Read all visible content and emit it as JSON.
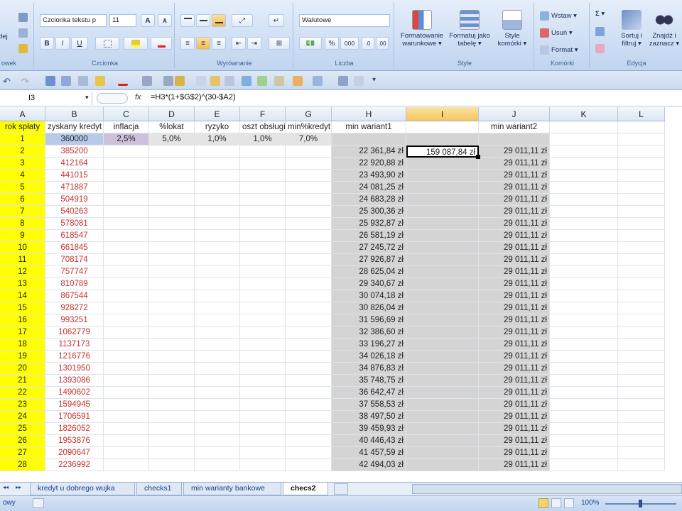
{
  "ribbon": {
    "groups": {
      "schowek": "owek",
      "czcionka": "Czcionka",
      "wyrownanie": "Wyrównanie",
      "liczba": "Liczba",
      "style": "Style",
      "komorki": "Komórki",
      "edycja": "Edycja"
    },
    "font_name": "Czcionka tekstu p",
    "font_size": "11",
    "number_format": "Walutowe",
    "paste_label": "dej",
    "bold": "B",
    "italic": "I",
    "underline": "U",
    "grow_font": "A",
    "shrink_font": "A",
    "percent": "%",
    "thousands": "000",
    "cond_format": "Formatowanie warunkowe ▾",
    "format_table": "Formatuj jako tabelę ▾",
    "cell_styles": "Style komórki ▾",
    "insert": "Wstaw ▾",
    "delete": "Usuń ▾",
    "format": "Format ▾",
    "sum": "Σ ▾",
    "sort": "Sortuj i filtruj ▾",
    "find": "Znajdź i zaznacz ▾"
  },
  "formula_bar": {
    "name_box": "I3",
    "fx": "fx",
    "formula": "=H3*(1+$G$2)^(30-$A2)"
  },
  "columns": [
    "A",
    "B",
    "C",
    "D",
    "E",
    "F",
    "G",
    "H",
    "I",
    "J",
    "K",
    "L"
  ],
  "headers_row1": {
    "A": "rok spłaty",
    "B": "zyskany kredyt",
    "C": "inflacja",
    "D": "%lokat",
    "E": "ryzyko",
    "F": "oszt obsługi",
    "G": "min%kredyt",
    "H": "min wariant1",
    "J": "min wariant2"
  },
  "row2": {
    "A": "1",
    "B": "360000",
    "C": "2,5%",
    "D": "5,0%",
    "E": "1,0%",
    "F": "1,0%",
    "G": "7,0%"
  },
  "active_cell_value": "159 087,84 zł",
  "rows": [
    {
      "a": "2",
      "b": "385200",
      "h": "22 361,84 zł",
      "j": "29 011,11 zł"
    },
    {
      "a": "3",
      "b": "412164",
      "h": "22 920,88 zł",
      "j": "29 011,11 zł"
    },
    {
      "a": "4",
      "b": "441015",
      "h": "23 493,90 zł",
      "j": "29 011,11 zł"
    },
    {
      "a": "5",
      "b": "471887",
      "h": "24 081,25 zł",
      "j": "29 011,11 zł"
    },
    {
      "a": "6",
      "b": "504919",
      "h": "24 683,28 zł",
      "j": "29 011,11 zł"
    },
    {
      "a": "7",
      "b": "540263",
      "h": "25 300,36 zł",
      "j": "29 011,11 zł"
    },
    {
      "a": "8",
      "b": "578081",
      "h": "25 932,87 zł",
      "j": "29 011,11 zł"
    },
    {
      "a": "9",
      "b": "618547",
      "h": "26 581,19 zł",
      "j": "29 011,11 zł"
    },
    {
      "a": "10",
      "b": "661845",
      "h": "27 245,72 zł",
      "j": "29 011,11 zł"
    },
    {
      "a": "11",
      "b": "708174",
      "h": "27 926,87 zł",
      "j": "29 011,11 zł"
    },
    {
      "a": "12",
      "b": "757747",
      "h": "28 625,04 zł",
      "j": "29 011,11 zł"
    },
    {
      "a": "13",
      "b": "810789",
      "h": "29 340,67 zł",
      "j": "29 011,11 zł"
    },
    {
      "a": "14",
      "b": "867544",
      "h": "30 074,18 zł",
      "j": "29 011,11 zł"
    },
    {
      "a": "15",
      "b": "928272",
      "h": "30 826,04 zł",
      "j": "29 011,11 zł"
    },
    {
      "a": "16",
      "b": "993251",
      "h": "31 596,69 zł",
      "j": "29 011,11 zł"
    },
    {
      "a": "17",
      "b": "1062779",
      "h": "32 386,60 zł",
      "j": "29 011,11 zł"
    },
    {
      "a": "18",
      "b": "1137173",
      "h": "33 196,27 zł",
      "j": "29 011,11 zł"
    },
    {
      "a": "19",
      "b": "1216776",
      "h": "34 026,18 zł",
      "j": "29 011,11 zł"
    },
    {
      "a": "20",
      "b": "1301950",
      "h": "34 876,83 zł",
      "j": "29 011,11 zł"
    },
    {
      "a": "21",
      "b": "1393086",
      "h": "35 748,75 zł",
      "j": "29 011,11 zł"
    },
    {
      "a": "22",
      "b": "1490602",
      "h": "36 642,47 zł",
      "j": "29 011,11 zł"
    },
    {
      "a": "23",
      "b": "1594945",
      "h": "37 558,53 zł",
      "j": "29 011,11 zł"
    },
    {
      "a": "24",
      "b": "1706591",
      "h": "38 497,50 zł",
      "j": "29 011,11 zł"
    },
    {
      "a": "25",
      "b": "1826052",
      "h": "39 459,93 zł",
      "j": "29 011,11 zł"
    },
    {
      "a": "26",
      "b": "1953876",
      "h": "40 446,43 zł",
      "j": "29 011,11 zł"
    },
    {
      "a": "27",
      "b": "2090647",
      "h": "41 457,59 zł",
      "j": "29 011,11 zł"
    },
    {
      "a": "28",
      "b": "2236992",
      "h": "42 494,03 zł",
      "j": "29 011,11 zł"
    }
  ],
  "sheet_tabs": [
    "kredyt u dobrego wujka",
    "checks1",
    "min warianty bankowe",
    "checs2"
  ],
  "active_tab": "checs2",
  "status": {
    "left": "owy",
    "zoom": "100%"
  },
  "colors": {
    "yellow": "#ffff00",
    "red_text": "#c8322d",
    "gray_fill": "#d4d4d4",
    "lilac": "#ccc0da",
    "accent": "#15428b"
  }
}
